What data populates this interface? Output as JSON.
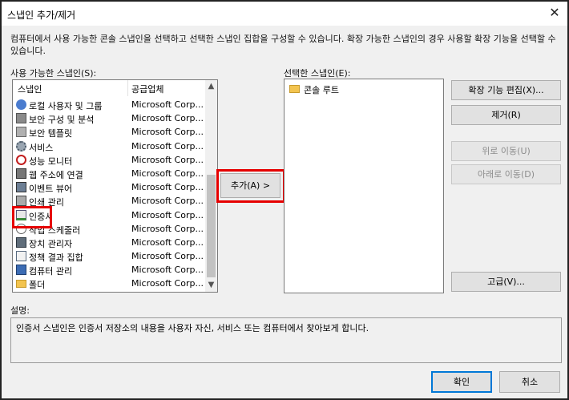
{
  "window": {
    "title": "스냅인 추가/제거",
    "close_glyph": "✕"
  },
  "intro_text": "컴퓨터에서 사용 가능한 콘솔 스냅인을 선택하고 선택한 스냅인 집합을 구성할 수 있습니다. 확장 가능한 스냅인의 경우 사용할 확장 기능을 선택할 수 있습니다.",
  "available": {
    "label": "사용 가능한 스냅인(S):",
    "col_name": "스냅인",
    "col_vendor": "공급업체",
    "items": [
      {
        "name": "로컬 사용자 및 그룹",
        "vendor": "Microsoft Corp...",
        "icon": "users-icon"
      },
      {
        "name": "보안 구성 및 분석",
        "vendor": "Microsoft Corp...",
        "icon": "security-analysis-icon"
      },
      {
        "name": "보안 템플릿",
        "vendor": "Microsoft Corp...",
        "icon": "security-template-icon"
      },
      {
        "name": "서비스",
        "vendor": "Microsoft Corp...",
        "icon": "services-gear-icon"
      },
      {
        "name": "성능 모니터",
        "vendor": "Microsoft Corp...",
        "icon": "performance-monitor-icon"
      },
      {
        "name": "웹 주소에 연결",
        "vendor": "Microsoft Corp...",
        "icon": "web-link-icon"
      },
      {
        "name": "이벤트 뷰어",
        "vendor": "Microsoft Corp...",
        "icon": "event-viewer-icon"
      },
      {
        "name": "인쇄 관리",
        "vendor": "Microsoft Corp...",
        "icon": "print-management-icon"
      },
      {
        "name": "인증서",
        "vendor": "Microsoft Corp...",
        "icon": "certificate-icon"
      },
      {
        "name": "작업 스케줄러",
        "vendor": "Microsoft Corp...",
        "icon": "task-scheduler-icon"
      },
      {
        "name": "장치 관리자",
        "vendor": "Microsoft Corp...",
        "icon": "device-manager-icon"
      },
      {
        "name": "정책 결과 집합",
        "vendor": "Microsoft Corp...",
        "icon": "policy-result-icon"
      },
      {
        "name": "컴퓨터 관리",
        "vendor": "Microsoft Corp...",
        "icon": "computer-management-icon"
      },
      {
        "name": "폴더",
        "vendor": "Microsoft Corp...",
        "icon": "folder-icon"
      }
    ]
  },
  "add_button": "추가(A) >",
  "selected": {
    "label": "선택한 스냅인(E):",
    "items": [
      {
        "name": "콘솔 루트",
        "icon": "folder-icon"
      }
    ]
  },
  "side_buttons": {
    "edit_extensions": "확장 기능 편집(X)...",
    "remove": "제거(R)",
    "move_up": "위로 이동(U)",
    "move_down": "아래로 이동(D)",
    "advanced": "고급(V)..."
  },
  "description": {
    "label": "설명:",
    "text": "인증서 스냅인은 인증서 저장소의 내용을 사용자 자신, 서비스 또는 컴퓨터에서 찾아보게 합니다."
  },
  "footer": {
    "ok": "확인",
    "cancel": "취소"
  },
  "colors": {
    "highlight": "#e60000",
    "default_button_border": "#0078d7",
    "folder": "#f3c44f"
  }
}
